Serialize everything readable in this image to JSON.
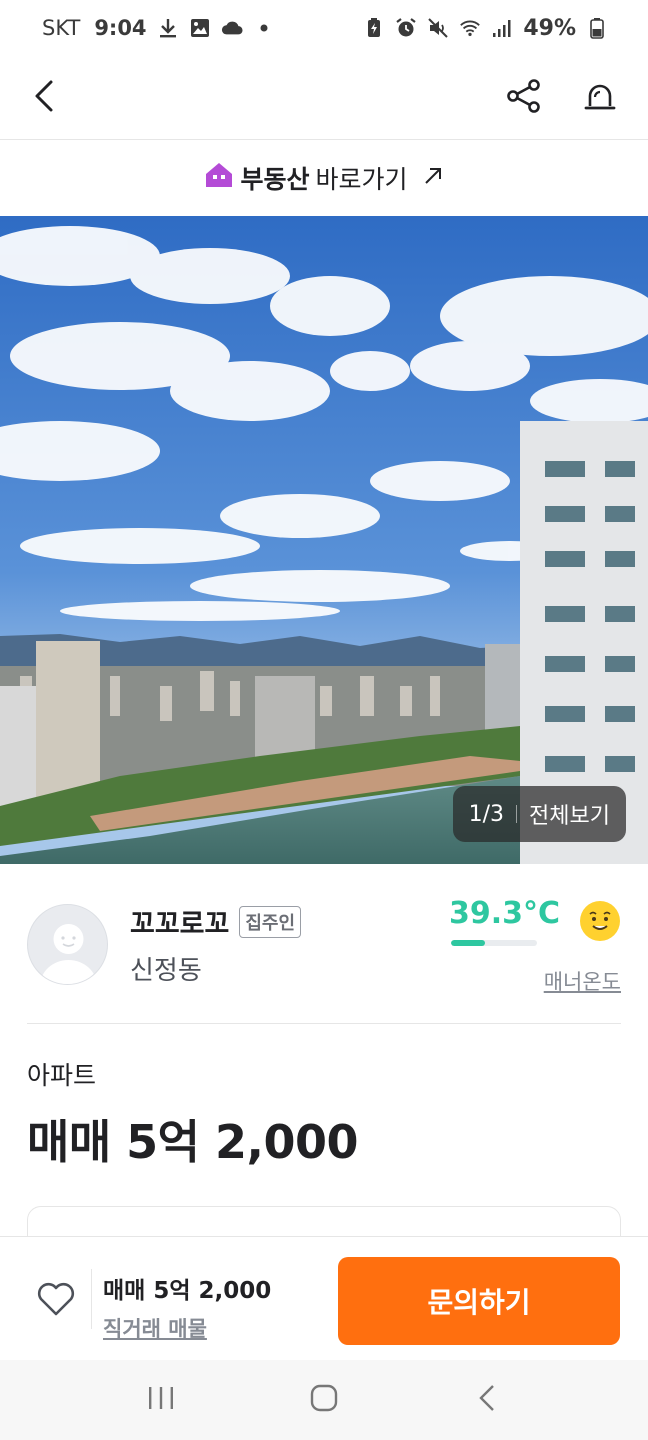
{
  "status_bar": {
    "carrier": "SKT",
    "time": "9:04",
    "battery_percent": "49%"
  },
  "header": {
    "back_icon": "chevron-left-icon",
    "share_icon": "share-icon",
    "report_icon": "siren-icon"
  },
  "realestate_banner": {
    "bold_text": "부동산",
    "normal_text": "바로가기",
    "arrow_icon": "arrow-up-right-icon",
    "house_color": "#b44bd6"
  },
  "hero": {
    "counter": "1/3",
    "view_all_label": "전체보기"
  },
  "profile": {
    "nickname": "꼬꼬로꼬",
    "badge": "집주인",
    "location": "신정동",
    "temperature": "39.3°C",
    "temperature_value": 39.3,
    "temperature_fill_fraction": 0.39,
    "temperature_color": "#2ec7a0",
    "manner_label": "매너온도"
  },
  "listing": {
    "category": "아파트",
    "price_title": "매매 5억 2,000"
  },
  "action_bar": {
    "price": "매매 5억 2,000",
    "sub_label": "직거래 매물",
    "inquire_label": "문의하기",
    "accent_color": "#ff6f0f"
  },
  "nav_bar": {
    "recent_icon": "recent-apps-icon",
    "home_icon": "home-icon",
    "back_icon": "back-icon"
  }
}
